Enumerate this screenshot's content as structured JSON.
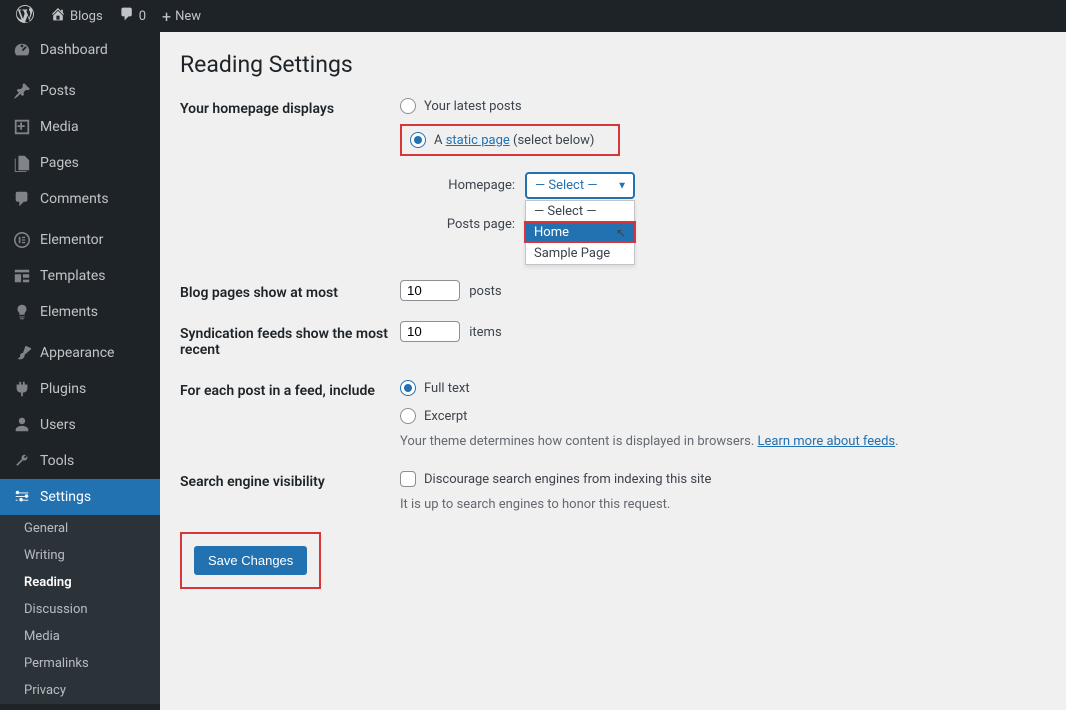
{
  "topbar": {
    "site": "Blogs",
    "comments": "0",
    "new": "New"
  },
  "sidebar": {
    "dashboard": "Dashboard",
    "posts": "Posts",
    "media": "Media",
    "pages": "Pages",
    "comments": "Comments",
    "elementor": "Elementor",
    "templates": "Templates",
    "elements": "Elements",
    "appearance": "Appearance",
    "plugins": "Plugins",
    "users": "Users",
    "tools": "Tools",
    "settings": "Settings",
    "submenu": {
      "general": "General",
      "writing": "Writing",
      "reading": "Reading",
      "discussion": "Discussion",
      "media": "Media",
      "permalinks": "Permalinks",
      "privacy": "Privacy"
    }
  },
  "page": {
    "title": "Reading Settings",
    "homepage_label": "Your homepage displays",
    "radio_latest": "Your latest posts",
    "radio_static_a": "A ",
    "radio_static_link": "static page",
    "radio_static_after": " (select below)",
    "homepage_select_label": "Homepage:",
    "posts_select_label": "Posts page:",
    "select_placeholder": "— Select —",
    "dropdown": {
      "opt0": "— Select —",
      "opt1": "Home",
      "opt2": "Sample Page"
    },
    "blog_pages_label": "Blog pages show at most",
    "blog_pages_value": "10",
    "blog_pages_after": "posts",
    "synd_label": "Syndication feeds show the most recent",
    "synd_value": "10",
    "synd_after": "items",
    "feed_label": "For each post in a feed, include",
    "feed_full": "Full text",
    "feed_excerpt": "Excerpt",
    "feed_desc_before": "Your theme determines how content is displayed in browsers. ",
    "feed_desc_link": "Learn more about feeds",
    "feed_desc_after": ".",
    "search_label": "Search engine visibility",
    "search_check": "Discourage search engines from indexing this site",
    "search_desc": "It is up to search engines to honor this request.",
    "save": "Save Changes"
  }
}
